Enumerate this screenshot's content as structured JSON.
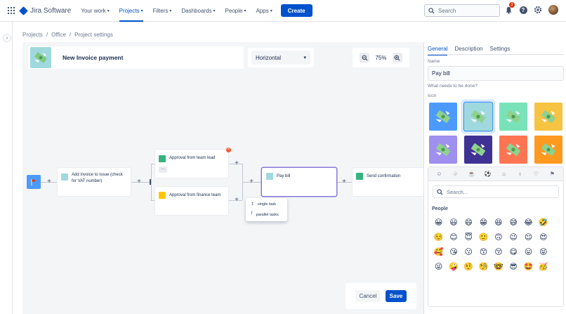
{
  "topnav": {
    "logo": "Jira Software",
    "items": [
      {
        "label": "Your work",
        "active": false
      },
      {
        "label": "Projects",
        "active": true
      },
      {
        "label": "Filters",
        "active": false
      },
      {
        "label": "Dashboards",
        "active": false
      },
      {
        "label": "People",
        "active": false
      },
      {
        "label": "Apps",
        "active": false
      }
    ],
    "create_label": "Create",
    "search_placeholder": "Search",
    "notification_count": "3"
  },
  "breadcrumb": {
    "items": [
      "Projects",
      "Office",
      "Project settings"
    ],
    "separator": "/"
  },
  "canvas": {
    "title": "New Invoice payment",
    "layout_value": "Horizontal",
    "zoom": "75%"
  },
  "flow": {
    "nodes": {
      "add_invoice": "Add invoice to issue (check for VAT number)",
      "approval_lead": "Approval from team lead",
      "approval_finance": "Approval from finance team",
      "pay_bill": "Pay bill",
      "send_confirmation": "Send confirmation"
    },
    "task_menu": {
      "single": "single task",
      "parallel": "parallel tasks"
    }
  },
  "footer": {
    "cancel_label": "Cancel",
    "save_label": "Save"
  },
  "panel": {
    "tabs": [
      "General",
      "Description",
      "Settings"
    ],
    "name_label": "Name",
    "name_value": "Pay bill",
    "hint": "What needs to be done?",
    "icon_label": "Icon",
    "icon_colors": [
      "#4c9aff",
      "#9fd9de",
      "#79e2b9",
      "#f6c342",
      "#9f8fef",
      "#403294",
      "#ff7452",
      "#ff991f"
    ],
    "selected_icon_index": 1,
    "emoji_search_placeholder": "Search...",
    "emoji_section": "People",
    "emoji_categories": [
      "smiley-icon",
      "nature-icon",
      "food-icon",
      "activity-icon",
      "travel-icon",
      "objects-icon",
      "symbols-icon",
      "flags-icon"
    ],
    "emojis": [
      "😀",
      "😃",
      "😄",
      "😁",
      "😆",
      "😅",
      "😂",
      "🤣",
      "☺️",
      "😊",
      "😇",
      "🙂",
      "🙃",
      "😉",
      "😌",
      "😍",
      "🥰",
      "😘",
      "😗",
      "😙",
      "😚",
      "😋",
      "😛",
      "😝",
      "😜",
      "🤪",
      "🤨",
      "🧐",
      "🤓",
      "😎",
      "🤩",
      "🥳"
    ]
  },
  "colors": {
    "accent": "#0052cc",
    "selected_node": "#8777d9",
    "flag": "#4c9aff"
  }
}
